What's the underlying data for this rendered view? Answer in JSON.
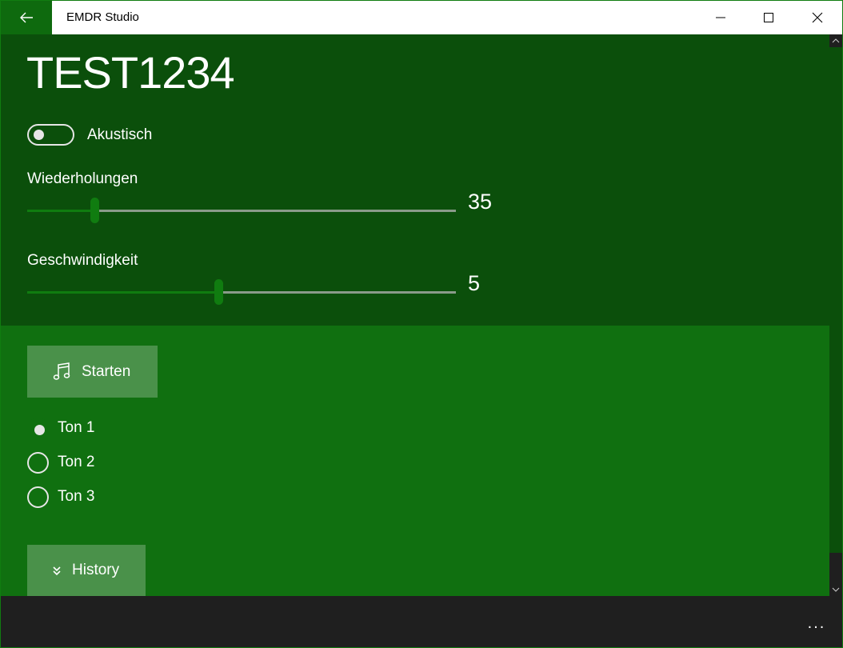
{
  "window": {
    "title": "EMDR Studio"
  },
  "page": {
    "title": "TEST1234"
  },
  "toggle": {
    "label": "Akustisch",
    "on": false
  },
  "sliders": [
    {
      "label": "Wiederholungen",
      "value": "35",
      "fraction": 0.156
    },
    {
      "label": "Geschwindigkeit",
      "value": "5",
      "fraction": 0.446
    }
  ],
  "start_button": {
    "label": "Starten",
    "icon": "music-notes-icon"
  },
  "tones": [
    {
      "label": "Ton 1",
      "selected": true
    },
    {
      "label": "Ton 2",
      "selected": false
    },
    {
      "label": "Ton 3",
      "selected": false
    }
  ],
  "history_button": {
    "label": "History",
    "icon": "double-chevron-down-icon"
  },
  "command_bar": {
    "more_label": "..."
  },
  "colors": {
    "accent": "#107c10",
    "top_bg": "#0b4f0b",
    "bottom_bg": "#107010",
    "button_bg": "#4a914a"
  }
}
